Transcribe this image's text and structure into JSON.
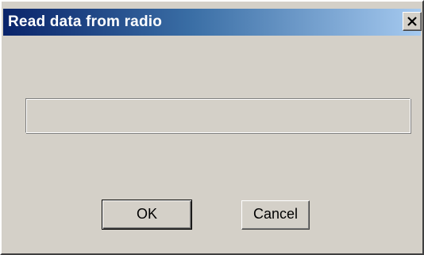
{
  "window": {
    "title": "Read data from radio"
  },
  "titlebar": {
    "close_icon": "close-x-icon",
    "gradient_start": "#0a246a",
    "gradient_end": "#a6caf0"
  },
  "progress": {
    "value": 0
  },
  "buttons": {
    "ok_label": "OK",
    "cancel_label": "Cancel"
  },
  "colors": {
    "dialog_background": "#d4d0c8",
    "title_text": "#ffffff"
  }
}
